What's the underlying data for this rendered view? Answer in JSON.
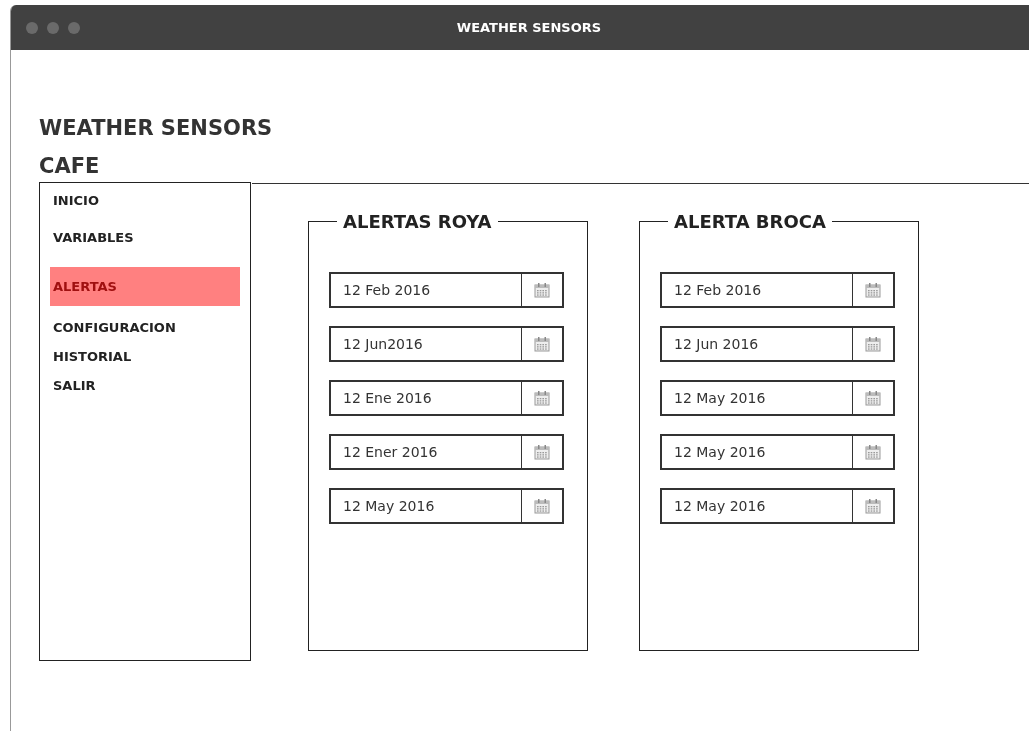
{
  "window": {
    "title": "WEATHER SENSORS"
  },
  "header": {
    "title": "WEATHER SENSORS",
    "subtitle": "CAFE"
  },
  "sidebar": {
    "items": [
      {
        "label": "INICIO",
        "selected": false
      },
      {
        "label": "VARIABLES",
        "selected": false
      },
      {
        "label": "ALERTAS",
        "selected": true
      },
      {
        "label": "CONFIGURACION",
        "selected": false
      },
      {
        "label": "HISTORIAL",
        "selected": false
      },
      {
        "label": "SALIR",
        "selected": false
      }
    ]
  },
  "panels": [
    {
      "title": "ALERTAS ROYA",
      "dates": [
        "12 Feb 2016",
        "12 Jun2016",
        "12 Ene 2016",
        "12 Ener 2016",
        "12 May 2016"
      ]
    },
    {
      "title": "ALERTA BROCA",
      "dates": [
        "12 Feb 2016",
        "12 Jun 2016",
        "12 May 2016",
        "12 May 2016",
        "12 May 2016"
      ]
    }
  ]
}
